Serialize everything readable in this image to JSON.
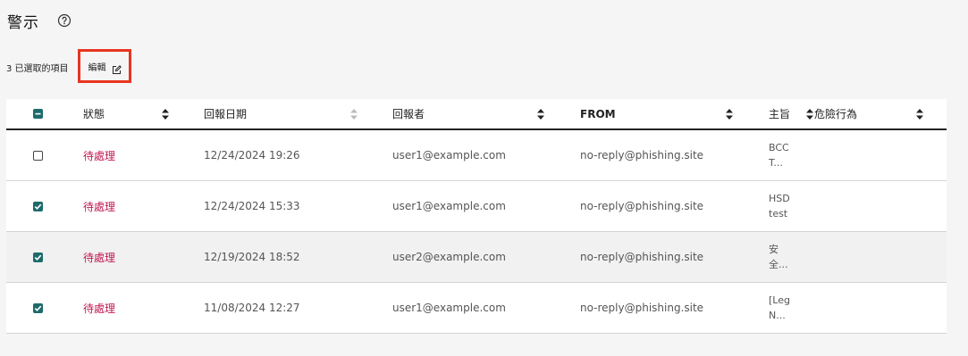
{
  "page": {
    "title": "警示"
  },
  "toolbar": {
    "selected_count_label": "3 已選取的項目",
    "edit_label": "編輯"
  },
  "table": {
    "headers": {
      "status": "狀態",
      "report_date": "回報日期",
      "reporter": "回報者",
      "from": "FROM",
      "subject": "主旨",
      "risk": "危險行為"
    },
    "rows": [
      {
        "checked": false,
        "status": "待處理",
        "date": "12/24/2024 19:26",
        "reporter": "user1@example.com",
        "from": "no-reply@phishing.site",
        "subject_line1": "BCC",
        "subject_line2": "T..."
      },
      {
        "checked": true,
        "status": "待處理",
        "date": "12/24/2024 15:33",
        "reporter": "user1@example.com",
        "from": "no-reply@phishing.site",
        "subject_line1": "HSD",
        "subject_line2": "test"
      },
      {
        "checked": true,
        "status": "待處理",
        "date": "12/19/2024 18:52",
        "reporter": "user2@example.com",
        "from": "no-reply@phishing.site",
        "subject_line1": "安",
        "subject_line2": "全..."
      },
      {
        "checked": true,
        "status": "待處理",
        "date": "11/08/2024 12:27",
        "reporter": "user1@example.com",
        "from": "no-reply@phishing.site",
        "subject_line1": "[Leg",
        "subject_line2": "N..."
      }
    ]
  },
  "colors": {
    "accent": "#1d6b6b",
    "status": "#c0184f",
    "highlight_border": "#e8351f"
  }
}
